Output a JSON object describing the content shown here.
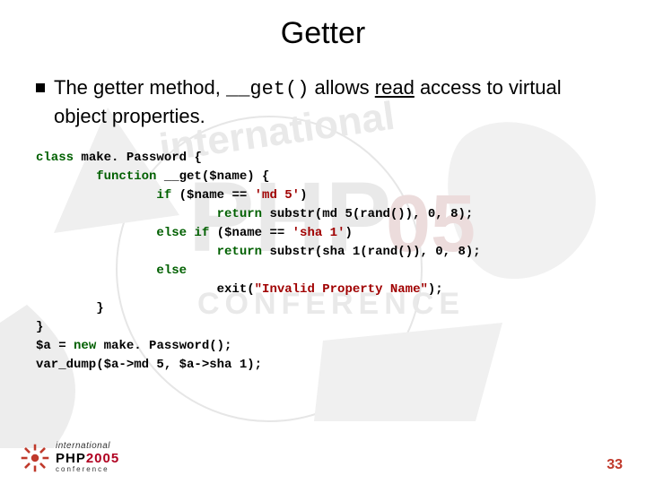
{
  "title": "Getter",
  "bullet": {
    "pre": "The getter method, ",
    "method": "__get()",
    "mid": " allows ",
    "emph": "read",
    "post": " access to virtual object properties."
  },
  "code": {
    "l1a": "class",
    "l1b": " make. Password {",
    "l2a": "        function",
    "l2b": " __get($name) {",
    "l3a": "                if",
    "l3b": " ($name == ",
    "l3c": "'md 5'",
    "l3d": ")",
    "l4a": "                        return",
    "l4b": " substr(md 5(rand()), 0, 8);",
    "l5a": "                else if",
    "l5b": " ($name == ",
    "l5c": "'sha 1'",
    "l5d": ")",
    "l6a": "                        return",
    "l6b": " substr(sha 1(rand()), 0, 8);",
    "l7a": "                else",
    "l8a": "                        exit(",
    "l8b": "\"Invalid Property Name\"",
    "l8c": ");",
    "l9": "        }",
    "l10": "}",
    "l11a": "$a = ",
    "l11b": "new",
    "l11c": " make. Password();",
    "l12": "var_dump($a->md 5, $a->sha 1);"
  },
  "logo": {
    "line1": "international",
    "line2a": "PHP",
    "line2b": "2005",
    "line3": "conference"
  },
  "page_number": "33"
}
